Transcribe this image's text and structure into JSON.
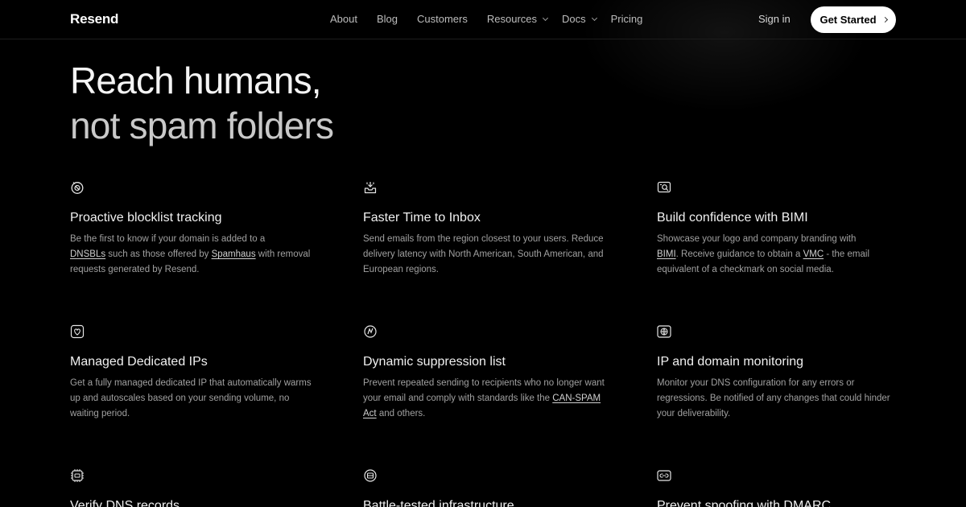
{
  "nav": {
    "logo": "Resend",
    "items": [
      {
        "label": "About"
      },
      {
        "label": "Blog"
      },
      {
        "label": "Customers"
      },
      {
        "label": "Resources"
      },
      {
        "label": "Docs"
      },
      {
        "label": "Pricing"
      }
    ],
    "sign_in": "Sign in",
    "cta": "Get Started"
  },
  "hero": {
    "line1": "Reach humans,",
    "line2": "not spam folders"
  },
  "features": [
    {
      "icon": "blocklist-icon",
      "title": "Proactive blocklist tracking",
      "d1": "Be the first to know if your domain is added to a",
      "l1": "DNSBLs",
      "d2": " such as those offered by ",
      "l2": "Spamhaus",
      "d3": " with removal requests generated by Resend."
    },
    {
      "icon": "inbox-icon",
      "title": "Faster Time to Inbox",
      "d1": "Send emails from the region closest to your users. Reduce delivery latency with North American, South American, and European regions."
    },
    {
      "icon": "bimi-icon",
      "title": "Build confidence with BIMI",
      "d1": "Showcase your logo and company branding with",
      "l1": "BIMI",
      "d2": ". Receive guidance to obtain a ",
      "l2": "VMC",
      "d3": " - the email equivalent of a checkmark on social media."
    },
    {
      "icon": "dedicated-ip-icon",
      "title": "Managed Dedicated IPs",
      "d1": "Get a fully managed dedicated IP that automatically warms up and autoscales based on your sending volume, no waiting period."
    },
    {
      "icon": "suppression-icon",
      "title": "Dynamic suppression list",
      "d1": "Prevent repeated sending to recipients who no longer want your email and comply with standards like the",
      "l1": "CAN-SPAM Act",
      "d2": " and others."
    },
    {
      "icon": "globe-icon",
      "title": "IP and domain monitoring",
      "d1": "Monitor your DNS configuration for any errors or regressions. Be notified of any changes that could hinder your deliverability."
    },
    {
      "icon": "dns-chip-icon",
      "title": "Verify DNS records"
    },
    {
      "icon": "infrastructure-icon",
      "title": "Battle-tested infrastructure"
    },
    {
      "icon": "dmarc-icon",
      "title": "Prevent spoofing with DMARC"
    }
  ]
}
